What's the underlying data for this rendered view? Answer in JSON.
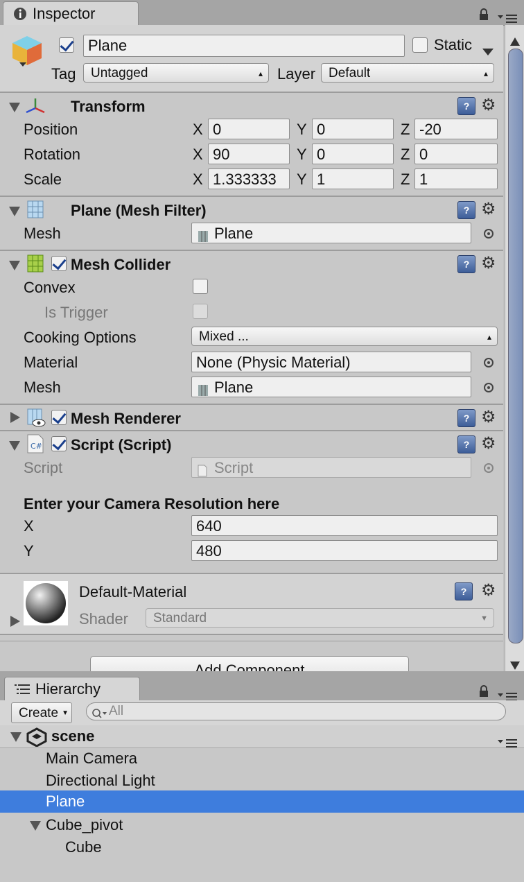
{
  "inspector_tab": {
    "label": "Inspector",
    "icon": "info-icon"
  },
  "object": {
    "name": "Plane",
    "active": true,
    "static_label": "Static",
    "tag_label": "Tag",
    "tag_value": "Untagged",
    "layer_label": "Layer",
    "layer_value": "Default"
  },
  "transform": {
    "title": "Transform",
    "rows": [
      {
        "label": "Position",
        "x": "0",
        "y": "0",
        "z": "-20"
      },
      {
        "label": "Rotation",
        "x": "90",
        "y": "0",
        "z": "0"
      },
      {
        "label": "Scale",
        "x": "1.333333",
        "y": "1",
        "z": "1"
      }
    ],
    "axis": {
      "x": "X",
      "y": "Y",
      "z": "Z"
    }
  },
  "mesh_filter": {
    "title": "Plane (Mesh Filter)",
    "mesh_label": "Mesh",
    "mesh_value": "Plane"
  },
  "mesh_collider": {
    "title": "Mesh Collider",
    "enabled": true,
    "convex_label": "Convex",
    "is_trigger_label": "Is Trigger",
    "cooking_label": "Cooking Options",
    "cooking_value": "Mixed ...",
    "material_label": "Material",
    "material_value": "None (Physic Material)",
    "mesh_label": "Mesh",
    "mesh_value": "Plane"
  },
  "mesh_renderer": {
    "title": "Mesh Renderer",
    "enabled": true
  },
  "script_component": {
    "title": "Script (Script)",
    "enabled": true,
    "script_label": "Script",
    "script_value": "Script",
    "header": "Enter your Camera Resolution here",
    "x_label": "X",
    "x_value": "640",
    "y_label": "Y",
    "y_value": "480"
  },
  "material": {
    "name": "Default-Material",
    "shader_label": "Shader",
    "shader_value": "Standard"
  },
  "add_component_label": "Add Component",
  "hierarchy": {
    "tab_label": "Hierarchy",
    "create_label": "Create",
    "search_placeholder": "All",
    "scene_name": "scene",
    "items": [
      {
        "label": "Main Camera"
      },
      {
        "label": "Directional Light"
      },
      {
        "label": "Plane",
        "selected": true
      },
      {
        "label": "Cube_pivot",
        "expanded": true
      },
      {
        "label": "Cube"
      }
    ]
  },
  "colors": {
    "selection": "#3e7ddd",
    "panel": "#c8c8c8",
    "tabbar": "#a5a5a5"
  }
}
